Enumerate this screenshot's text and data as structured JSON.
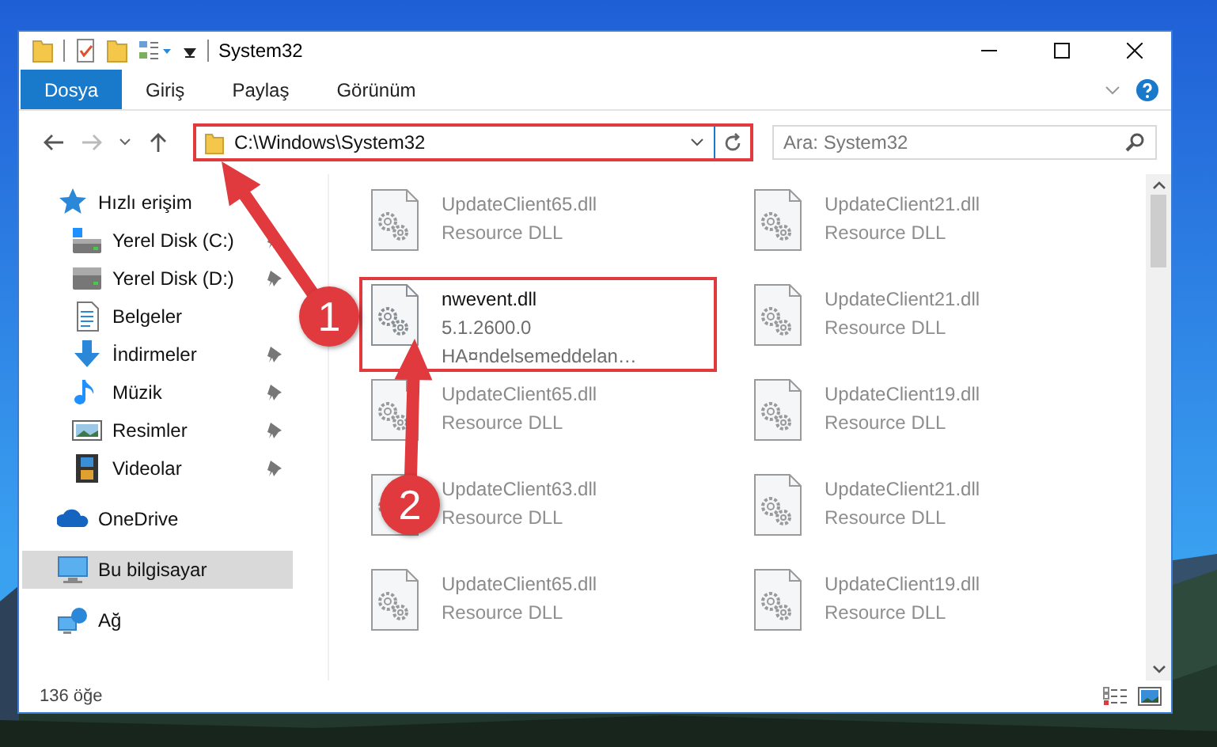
{
  "window": {
    "title": "System32"
  },
  "ribbon": {
    "tabs": [
      {
        "label": "Dosya",
        "selected": true
      },
      {
        "label": "Giriş",
        "selected": false
      },
      {
        "label": "Paylaş",
        "selected": false
      },
      {
        "label": "Görünüm",
        "selected": false
      }
    ]
  },
  "address_bar": {
    "path": "C:\\Windows\\System32",
    "highlighted": true
  },
  "search": {
    "placeholder": "Ara: System32"
  },
  "nav_pane": {
    "items": [
      {
        "label": "Hızlı erişim",
        "kind": "star",
        "pinned": false,
        "selected": false,
        "children": [
          {
            "label": "Yerel Disk (C:)",
            "kind": "drive-c",
            "pinned": true,
            "selected": false
          },
          {
            "label": "Yerel Disk (D:)",
            "kind": "drive",
            "pinned": true,
            "selected": false
          },
          {
            "label": "Belgeler",
            "kind": "document",
            "pinned": false,
            "selected": false
          },
          {
            "label": "İndirmeler",
            "kind": "download",
            "pinned": true,
            "selected": false
          },
          {
            "label": "Müzik",
            "kind": "music",
            "pinned": true,
            "selected": false
          },
          {
            "label": "Resimler",
            "pinned": true,
            "selected": false
          },
          {
            "label": "Videolar",
            "kind": "video",
            "pinned": true,
            "selected": false
          }
        ]
      },
      {
        "label": "OneDrive",
        "kind": "cloud",
        "pinned": false,
        "selected": false
      },
      {
        "label": "Bu bilgisayar",
        "kind": "computer",
        "pinned": false,
        "selected": true
      },
      {
        "label": "Ağ",
        "kind": "network",
        "pinned": false,
        "selected": false
      }
    ]
  },
  "files": [
    {
      "name": "UpdateClient65.dll",
      "details": [
        "Resource DLL"
      ],
      "blurred": true,
      "highlighted": false
    },
    {
      "name": "UpdateClient21.dll",
      "details": [
        "Resource DLL"
      ],
      "blurred": true,
      "highlighted": false
    },
    {
      "name": "nwevent.dll",
      "details": [
        "5.1.2600.0",
        "HA¤ndelsemeddelan…"
      ],
      "blurred": false,
      "highlighted": true
    },
    {
      "name": "UpdateClient21.dll",
      "details": [
        "Resource DLL"
      ],
      "blurred": true,
      "highlighted": false
    },
    {
      "name": "UpdateClient65.dll",
      "details": [
        "Resource DLL"
      ],
      "blurred": true,
      "highlighted": false
    },
    {
      "name": "UpdateClient19.dll",
      "details": [
        "Resource DLL"
      ],
      "blurred": true,
      "highlighted": false
    },
    {
      "name": "UpdateClient63.dll",
      "details": [
        "Resource DLL"
      ],
      "blurred": true,
      "highlighted": false
    },
    {
      "name": "UpdateClient21.dll",
      "details": [
        "Resource DLL"
      ],
      "blurred": true,
      "highlighted": false
    },
    {
      "name": "UpdateClient65.dll",
      "details": [
        "Resource DLL"
      ],
      "blurred": true,
      "highlighted": false
    },
    {
      "name": "UpdateClient19.dll",
      "details": [
        "Resource DLL"
      ],
      "blurred": true,
      "highlighted": false
    }
  ],
  "status_bar": {
    "item_count": "136 öğe"
  },
  "annotations": [
    {
      "number": "1"
    },
    {
      "number": "2"
    }
  ]
}
